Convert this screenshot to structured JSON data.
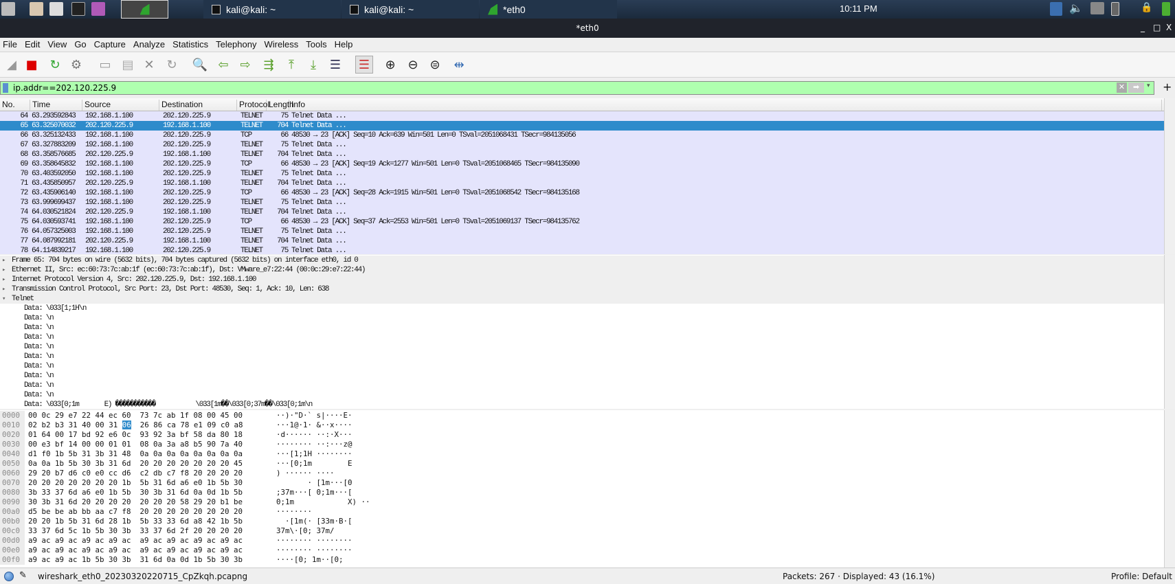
{
  "taskbar": {
    "tasks": [
      {
        "label": "kali@kali: ~",
        "icon": "terminal-icon"
      },
      {
        "label": "kali@kali: ~",
        "icon": "terminal-icon"
      },
      {
        "label": "*eth0",
        "icon": "wireshark-icon"
      }
    ],
    "clock": "10:11 PM"
  },
  "window": {
    "title": "*eth0",
    "minimize": "_",
    "maximize": "□",
    "close": "X"
  },
  "menu": [
    "File",
    "Edit",
    "View",
    "Go",
    "Capture",
    "Analyze",
    "Statistics",
    "Telephony",
    "Wireless",
    "Tools",
    "Help"
  ],
  "toolbar": [
    "start-capture",
    "stop-capture",
    "restart-capture",
    "capture-options",
    "open-file",
    "save-file",
    "close-file",
    "reload-file",
    "find-packet",
    "go-back",
    "go-forward",
    "go-to-packet",
    "first-packet",
    "last-packet",
    "auto-scroll",
    "colorize",
    "zoom-in",
    "zoom-out",
    "normal-size",
    "resize-columns"
  ],
  "filter": {
    "value": "ip.addr==202.120.225.9",
    "color": "#afffaf"
  },
  "packet_list": {
    "columns": [
      "No.",
      "Time",
      "Source",
      "Destination",
      "Protocol",
      "Length",
      "Info"
    ],
    "selected": 65,
    "rows": [
      [
        "64",
        "63.293592843",
        "192.168.1.100",
        "202.120.225.9",
        "TELNET",
        "75",
        "Telnet Data ..."
      ],
      [
        "65",
        "63.325070032",
        "202.120.225.9",
        "192.168.1.100",
        "TELNET",
        "704",
        "Telnet Data ..."
      ],
      [
        "66",
        "63.325132433",
        "192.168.1.100",
        "202.120.225.9",
        "TCP",
        "66",
        "48530 → 23 [ACK] Seq=10 Ack=639 Win=501 Len=0 TSval=2051068431 TSecr=984135056"
      ],
      [
        "67",
        "63.327883209",
        "192.168.1.100",
        "202.120.225.9",
        "TELNET",
        "75",
        "Telnet Data ..."
      ],
      [
        "68",
        "63.358576685",
        "202.120.225.9",
        "192.168.1.100",
        "TELNET",
        "704",
        "Telnet Data ..."
      ],
      [
        "69",
        "63.358645832",
        "192.168.1.100",
        "202.120.225.9",
        "TCP",
        "66",
        "48530 → 23 [ACK] Seq=19 Ack=1277 Win=501 Len=0 TSval=2051068465 TSecr=984135090"
      ],
      [
        "70",
        "63.403592050",
        "192.168.1.100",
        "202.120.225.9",
        "TELNET",
        "75",
        "Telnet Data ..."
      ],
      [
        "71",
        "63.435850957",
        "202.120.225.9",
        "192.168.1.100",
        "TELNET",
        "704",
        "Telnet Data ..."
      ],
      [
        "72",
        "63.435906140",
        "192.168.1.100",
        "202.120.225.9",
        "TCP",
        "66",
        "48530 → 23 [ACK] Seq=28 Ack=1915 Win=501 Len=0 TSval=2051068542 TSecr=984135168"
      ],
      [
        "73",
        "63.999699437",
        "192.168.1.100",
        "202.120.225.9",
        "TELNET",
        "75",
        "Telnet Data ..."
      ],
      [
        "74",
        "64.030521824",
        "202.120.225.9",
        "192.168.1.100",
        "TELNET",
        "704",
        "Telnet Data ..."
      ],
      [
        "75",
        "64.030593741",
        "192.168.1.100",
        "202.120.225.9",
        "TCP",
        "66",
        "48530 → 23 [ACK] Seq=37 Ack=2553 Win=501 Len=0 TSval=2051069137 TSecr=984135762"
      ],
      [
        "76",
        "64.057325003",
        "192.168.1.100",
        "202.120.225.9",
        "TELNET",
        "75",
        "Telnet Data ..."
      ],
      [
        "77",
        "64.087992181",
        "202.120.225.9",
        "192.168.1.100",
        "TELNET",
        "704",
        "Telnet Data ..."
      ],
      [
        "78",
        "64.114839217",
        "192.168.1.100",
        "202.120.225.9",
        "TELNET",
        "75",
        "Telnet Data ..."
      ]
    ]
  },
  "details": [
    {
      "text": "Frame 65: 704 bytes on wire (5632 bits), 704 bytes captured (5632 bits) on interface eth0, id 0",
      "toggle": "▸",
      "level": 0
    },
    {
      "text": "Ethernet II, Src: ec:60:73:7c:ab:1f (ec:60:73:7c:ab:1f), Dst: VMware_e7:22:44 (00:0c:29:e7:22:44)",
      "toggle": "▸",
      "level": 0
    },
    {
      "text": "Internet Protocol Version 4, Src: 202.120.225.9, Dst: 192.168.1.100",
      "toggle": "▸",
      "level": 0
    },
    {
      "text": "Transmission Control Protocol, Src Port: 23, Dst Port: 48530, Seq: 1, Ack: 10, Len: 638",
      "toggle": "▸",
      "level": 0
    },
    {
      "text": "Telnet",
      "toggle": "▾",
      "level": 0
    },
    {
      "text": "Data: \\033[1;1H\\n",
      "level": 1
    },
    {
      "text": "Data: \\n",
      "level": 1
    },
    {
      "text": "Data: \\n",
      "level": 1
    },
    {
      "text": "Data: \\n",
      "level": 1
    },
    {
      "text": "Data: \\n",
      "level": 1
    },
    {
      "text": "Data: \\n",
      "level": 1
    },
    {
      "text": "Data: \\n",
      "level": 1
    },
    {
      "text": "Data: \\n",
      "level": 1
    },
    {
      "text": "Data: \\n",
      "level": 1
    },
    {
      "text": "Data: \\n",
      "level": 1
    },
    {
      "text": "Data: \\033[0;1m       E) �����������           \\033[1m��\\033[0;37m��\\033[0;1m\\n",
      "level": 1
    }
  ],
  "hex": [
    [
      "0000",
      "00 0c 29 e7 22 44 ec 60  73 7c ab 1f 08 00 45 00",
      "··)·\"D·` s|····E·"
    ],
    [
      "0010",
      "02 b2 b3 31 40 00 31 06  26 86 ca 78 e1 09 c0 a8",
      "···1@·1· &··x····"
    ],
    [
      "0020",
      "01 64 00 17 bd 92 e6 0c  93 92 3a bf 58 da 80 18",
      "·d······ ··:·X···"
    ],
    [
      "0030",
      "00 e3 bf 14 00 00 01 01  08 0a 3a a8 b5 90 7a 40",
      "········ ··:···z@"
    ],
    [
      "0040",
      "d1 f0 1b 5b 31 3b 31 48  0a 0a 0a 0a 0a 0a 0a 0a",
      "···[1;1H ········"
    ],
    [
      "0050",
      "0a 0a 1b 5b 30 3b 31 6d  20 20 20 20 20 20 20 45",
      "···[0;1m        E"
    ],
    [
      "0060",
      "29 20 b7 d6 c0 e0 cc d6  c2 db c7 f8 20 20 20 20",
      ") ······ ····    "
    ],
    [
      "0070",
      "20 20 20 20 20 20 20 1b  5b 31 6d a6 e0 1b 5b 30",
      "       · [1m···[0"
    ],
    [
      "0080",
      "3b 33 37 6d a6 e0 1b 5b  30 3b 31 6d 0a 0d 1b 5b",
      ";37m···[ 0;1m···["
    ],
    [
      "0090",
      "30 3b 31 6d 20 20 20 20  20 20 20 58 29 20 b1 be",
      "0;1m            X) ··"
    ],
    [
      "00a0",
      "d5 be be ab bb aa c7 f8  20 20 20 20 20 20 20 20",
      "········         "
    ],
    [
      "00b0",
      "20 20 1b 5b 31 6d 28 1b  5b 33 33 6d a8 42 1b 5b",
      "  ·[1m(· [33m·B·["
    ],
    [
      "00c0",
      "33 37 6d 5c 1b 5b 30 3b  33 37 6d 2f 20 20 20 20",
      "37m\\·[0; 37m/    "
    ],
    [
      "00d0",
      "a9 ac a9 ac a9 ac a9 ac  a9 ac a9 ac a9 ac a9 ac",
      "········ ········"
    ],
    [
      "00e0",
      "a9 ac a9 ac a9 ac a9 ac  a9 ac a9 ac a9 ac a9 ac",
      "········ ········"
    ],
    [
      "00f0",
      "a9 ac a9 ac 1b 5b 30 3b  31 6d 0a 0d 1b 5b 30 3b",
      "····[0; 1m··[0;"
    ]
  ],
  "hex_selected": {
    "row": 1,
    "byte": 7
  },
  "status": {
    "file": "wireshark_eth0_20230320220715_CpZkqh.pcapng",
    "packets": "Packets: 267 · Displayed: 43 (16.1%)",
    "profile": "Profile: Default"
  },
  "colors": {
    "selected_row": "#2e8bcb",
    "row_bg": "#e4e4fc",
    "filter_valid": "#afffaf",
    "stop_red": "#dd0000"
  }
}
